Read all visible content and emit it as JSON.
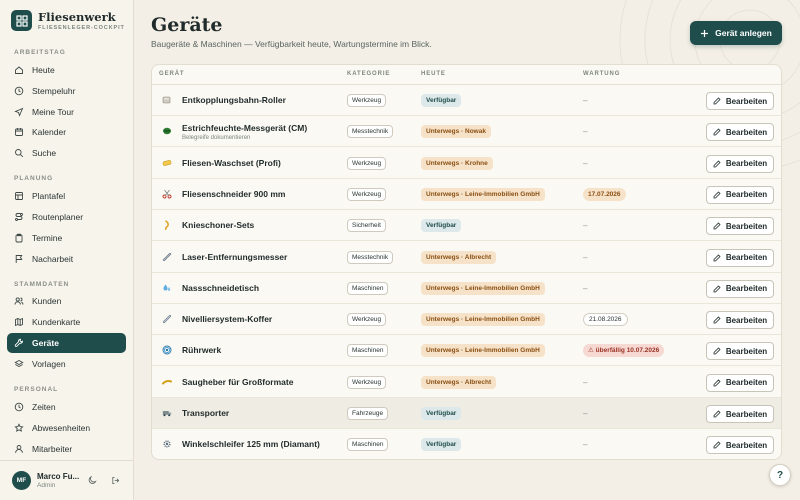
{
  "brand": {
    "title": "Fliesenwerk",
    "subtitle": "FLIESENLEGER-COCKPIT"
  },
  "sidebar": {
    "sections": [
      {
        "label": "ARBEITSTAG"
      },
      {
        "label": "PLANUNG"
      },
      {
        "label": "STAMMDATEN"
      },
      {
        "label": "PERSONAL"
      }
    ],
    "items": [
      {
        "label": "Heute",
        "icon": "home-icon"
      },
      {
        "label": "Stempeluhr",
        "icon": "clock-icon"
      },
      {
        "label": "Meine Tour",
        "icon": "navigation-icon"
      },
      {
        "label": "Kalender",
        "icon": "calendar-icon"
      },
      {
        "label": "Suche",
        "icon": "search-icon"
      },
      {
        "label": "Plantafel",
        "icon": "grid-icon"
      },
      {
        "label": "Routenplaner",
        "icon": "route-icon"
      },
      {
        "label": "Termine",
        "icon": "clipboard-icon"
      },
      {
        "label": "Nacharbeit",
        "icon": "flag-icon"
      },
      {
        "label": "Kunden",
        "icon": "users-icon"
      },
      {
        "label": "Kundenkarte",
        "icon": "map-icon"
      },
      {
        "label": "Geräte",
        "icon": "tool-icon",
        "active": true
      },
      {
        "label": "Vorlagen",
        "icon": "layers-icon"
      },
      {
        "label": "Zeiten",
        "icon": "clock-icon"
      },
      {
        "label": "Abwesenheiten",
        "icon": "star-icon"
      },
      {
        "label": "Mitarbeiter",
        "icon": "user-icon"
      }
    ]
  },
  "user": {
    "initials": "MF",
    "name": "Marco Fu...",
    "role": "Admin"
  },
  "page": {
    "title": "Geräte",
    "subtitle": "Baugeräte & Maschinen — Verfügbarkeit heute, Wartungstermine im Blick.",
    "add_button": "Gerät anlegen"
  },
  "table": {
    "columns": [
      "GERÄT",
      "KATEGORIE",
      "HEUTE",
      "WARTUNG"
    ],
    "edit_label": "Bearbeiten",
    "rows": [
      {
        "name": "Entkopplungsbahn-Roller",
        "category": "Werkzeug",
        "status": "Verfügbar",
        "status_type": "avail",
        "maintenance": "–",
        "maint_type": "none",
        "icon": "roller-icon"
      },
      {
        "name": "Estrichfeuchte-Messgerät (CM)",
        "note": "Belegreife dokumentieren",
        "category": "Messtechnik",
        "status": "Unterwegs · Nowak",
        "status_type": "away",
        "maintenance": "–",
        "maint_type": "none",
        "icon": "meter-icon"
      },
      {
        "name": "Fliesen-Waschset (Profi)",
        "category": "Werkzeug",
        "status": "Unterwegs · Krohne",
        "status_type": "away",
        "maintenance": "–",
        "maint_type": "none",
        "icon": "sponge-icon"
      },
      {
        "name": "Fliesenschneider 900 mm",
        "category": "Werkzeug",
        "status": "Unterwegs · Leine-Immobilien GmbH",
        "status_type": "away",
        "maintenance": "17.07.2026",
        "maint_type": "soon",
        "icon": "scissors-icon"
      },
      {
        "name": "Knieschoner-Sets",
        "category": "Sicherheit",
        "status": "Verfügbar",
        "status_type": "avail",
        "maintenance": "–",
        "maint_type": "none",
        "icon": "knee-icon"
      },
      {
        "name": "Laser-Entfernungsmesser",
        "category": "Messtechnik",
        "status": "Unterwegs · Albrecht",
        "status_type": "away",
        "maintenance": "–",
        "maint_type": "none",
        "icon": "laser-icon"
      },
      {
        "name": "Nassschneidetisch",
        "category": "Maschinen",
        "status": "Unterwegs · Leine-Immobilien GmbH",
        "status_type": "away",
        "maintenance": "–",
        "maint_type": "none",
        "icon": "water-icon"
      },
      {
        "name": "Nivelliersystem-Koffer",
        "category": "Werkzeug",
        "status": "Unterwegs · Leine-Immobilien GmbH",
        "status_type": "away",
        "maintenance": "21.08.2026",
        "maint_type": "date",
        "icon": "level-icon"
      },
      {
        "name": "Rührwerk",
        "category": "Maschinen",
        "status": "Unterwegs · Leine-Immobilien GmbH",
        "status_type": "away",
        "maintenance": "⚠ überfällig 10.07.2026",
        "maint_type": "over",
        "icon": "spiral-icon"
      },
      {
        "name": "Saugheber für Großformate",
        "category": "Werkzeug",
        "status": "Unterwegs · Albrecht",
        "status_type": "away",
        "maintenance": "–",
        "maint_type": "none",
        "icon": "lifter-icon"
      },
      {
        "name": "Transporter",
        "category": "Fahrzeuge",
        "status": "Verfügbar",
        "status_type": "avail",
        "maintenance": "–",
        "maint_type": "none",
        "icon": "van-icon",
        "hover": true
      },
      {
        "name": "Winkelschleifer 125 mm (Diamant)",
        "category": "Maschinen",
        "status": "Verfügbar",
        "status_type": "avail",
        "maintenance": "–",
        "maint_type": "none",
        "icon": "gear-icon"
      }
    ]
  },
  "help_label": "?"
}
